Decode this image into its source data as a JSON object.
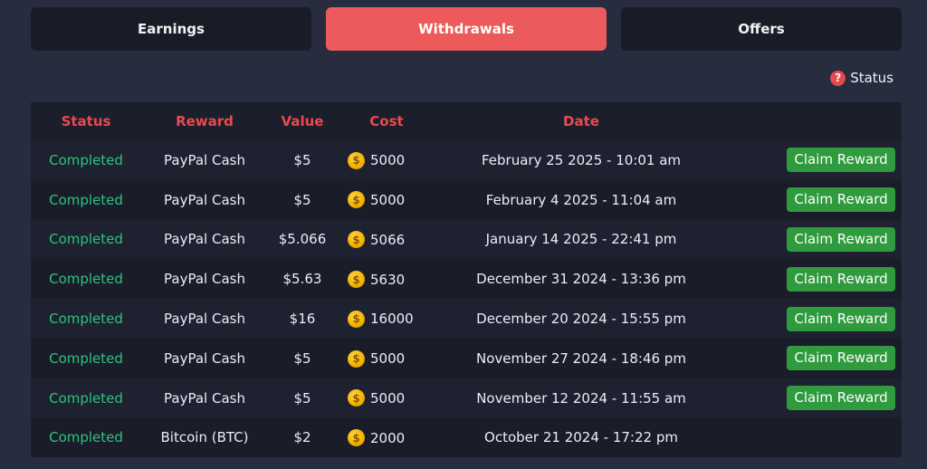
{
  "tabs": [
    {
      "label": "Earnings",
      "active": false
    },
    {
      "label": "Withdrawals",
      "active": true
    },
    {
      "label": "Offers",
      "active": false
    }
  ],
  "status_help": {
    "icon": "question-circle-icon",
    "label": "Status"
  },
  "table": {
    "headers": {
      "status": "Status",
      "reward": "Reward",
      "value": "Value",
      "cost": "Cost",
      "date": "Date"
    },
    "claim_label": "Claim Reward",
    "rows": [
      {
        "status": "Completed",
        "reward": "PayPal Cash",
        "value": "$5",
        "cost": "5000",
        "date": "February 25 2025 - 10:01 am",
        "claimable": true
      },
      {
        "status": "Completed",
        "reward": "PayPal Cash",
        "value": "$5",
        "cost": "5000",
        "date": "February 4 2025 - 11:04 am",
        "claimable": true
      },
      {
        "status": "Completed",
        "reward": "PayPal Cash",
        "value": "$5.066",
        "cost": "5066",
        "date": "January 14 2025 - 22:41 pm",
        "claimable": true
      },
      {
        "status": "Completed",
        "reward": "PayPal Cash",
        "value": "$5.63",
        "cost": "5630",
        "date": "December 31 2024 - 13:36 pm",
        "claimable": true
      },
      {
        "status": "Completed",
        "reward": "PayPal Cash",
        "value": "$16",
        "cost": "16000",
        "date": "December 20 2024 - 15:55 pm",
        "claimable": true
      },
      {
        "status": "Completed",
        "reward": "PayPal Cash",
        "value": "$5",
        "cost": "5000",
        "date": "November 27 2024 - 18:46 pm",
        "claimable": true
      },
      {
        "status": "Completed",
        "reward": "PayPal Cash",
        "value": "$5",
        "cost": "5000",
        "date": "November 12 2024 - 11:55 am",
        "claimable": true
      },
      {
        "status": "Completed",
        "reward": "Bitcoin (BTC)",
        "value": "$2",
        "cost": "2000",
        "date": "October 21 2024 - 17:22 pm",
        "claimable": false
      }
    ]
  },
  "colors": {
    "accent": "#ec5a5b",
    "completed": "#2ec27e",
    "claim": "#2f9a3e",
    "background": "#272c3f"
  }
}
